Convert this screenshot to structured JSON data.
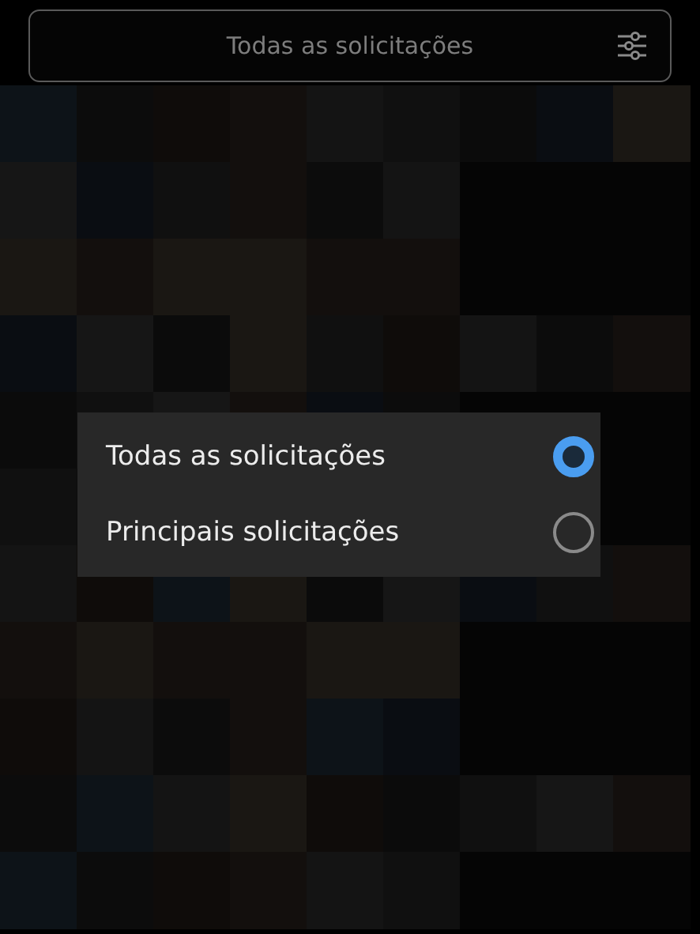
{
  "filter_bar": {
    "label": "Todas as solicitações"
  },
  "menu": {
    "options": [
      {
        "label": "Todas as solicitações",
        "selected": true
      },
      {
        "label": "Principais solicitações",
        "selected": false
      }
    ]
  }
}
